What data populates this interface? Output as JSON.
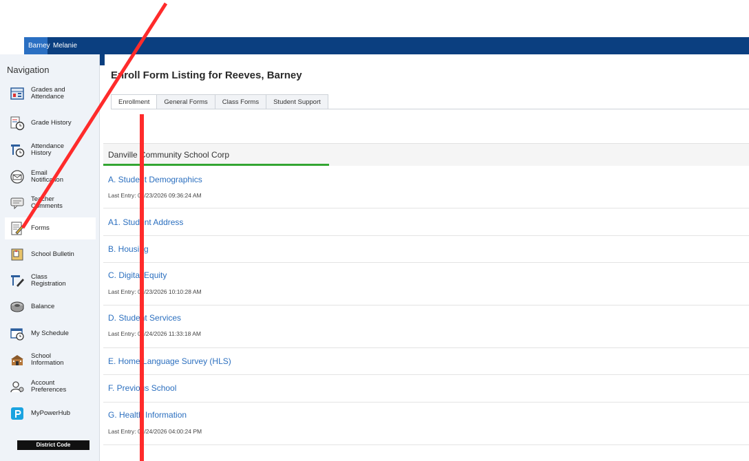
{
  "student_tabs": [
    "Barney",
    "Melanie"
  ],
  "navigation": {
    "title": "Navigation",
    "items": [
      {
        "label": "Grades and Attendance",
        "line1": "Grades and",
        "line2": "Attendance",
        "icon": "grades-icon"
      },
      {
        "label": "Grade History",
        "line1": "Grade History",
        "line2": "",
        "icon": "grade-history-icon"
      },
      {
        "label": "Attendance History",
        "line1": "Attendance",
        "line2": "History",
        "icon": "attendance-history-icon"
      },
      {
        "label": "Email Notification",
        "line1": "Email",
        "line2": "Notification",
        "icon": "email-icon"
      },
      {
        "label": "Teacher Comments",
        "line1": "Teacher",
        "line2": "Comments",
        "icon": "comments-icon"
      },
      {
        "label": "Forms",
        "line1": "Forms",
        "line2": "",
        "icon": "forms-icon",
        "active": true
      },
      {
        "label": "School Bulletin",
        "line1": "School Bulletin",
        "line2": "",
        "icon": "bulletin-icon"
      },
      {
        "label": "Class Registration",
        "line1": "Class",
        "line2": "Registration",
        "icon": "class-registration-icon"
      },
      {
        "label": "Balance",
        "line1": "Balance",
        "line2": "",
        "icon": "balance-icon"
      },
      {
        "label": "My Schedule",
        "line1": "My Schedule",
        "line2": "",
        "icon": "schedule-icon"
      },
      {
        "label": "School Information",
        "line1": "School",
        "line2": "Information",
        "icon": "school-icon"
      },
      {
        "label": "Account Preferences",
        "line1": "Account",
        "line2": "Preferences",
        "icon": "account-icon"
      },
      {
        "label": "MyPowerHub",
        "line1": "MyPowerHub",
        "line2": "",
        "icon": "powerhub-icon"
      }
    ],
    "district_code": "District Code"
  },
  "page": {
    "title": "Enroll Form Listing for Reeves, Barney",
    "tabs": [
      "Enrollment",
      "General Forms",
      "Class Forms",
      "Student Support"
    ],
    "school": "Danville Community School Corp",
    "forms": [
      {
        "title": "A. Student Demographics",
        "entry": "Last Entry: 02/23/2026 09:36:24 AM"
      },
      {
        "title": "A1. Student Address",
        "entry": ""
      },
      {
        "title": "B. Housing",
        "entry": ""
      },
      {
        "title": "C. Digital Equity",
        "entry": "Last Entry: 02/23/2026 10:10:28 AM"
      },
      {
        "title": "D. Student Services",
        "entry": "Last Entry: 02/24/2026 11:33:18 AM"
      },
      {
        "title": "E. Home Language Survey (HLS)",
        "entry": ""
      },
      {
        "title": "F. Previous School",
        "entry": ""
      },
      {
        "title": "G. Health Information",
        "entry": "Last Entry: 02/24/2026 04:00:24 PM"
      }
    ]
  },
  "colors": {
    "header_blue": "#0b3f80",
    "link_blue": "#2b6fbf",
    "progress_green": "#33a532",
    "annotation_red": "#ff2b2b"
  }
}
